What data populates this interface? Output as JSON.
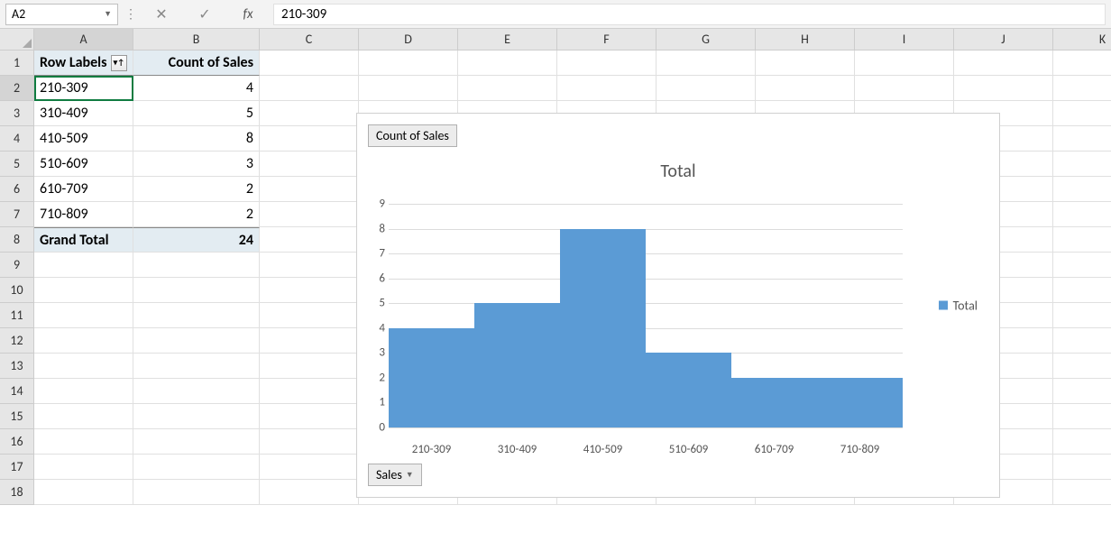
{
  "namebox": "A2",
  "formula": "210-309",
  "columns": [
    "A",
    "B",
    "C",
    "D",
    "E",
    "F",
    "G",
    "H",
    "I",
    "J",
    "K"
  ],
  "rowcount": 18,
  "pivot": {
    "header_rowlabels": "Row Labels",
    "header_count": "Count of Sales",
    "rows": [
      {
        "label": "210-309",
        "count": 4
      },
      {
        "label": "310-409",
        "count": 5
      },
      {
        "label": "410-509",
        "count": 8
      },
      {
        "label": "510-609",
        "count": 3
      },
      {
        "label": "610-709",
        "count": 2
      },
      {
        "label": "710-809",
        "count": 2
      }
    ],
    "grand_label": "Grand Total",
    "grand_value": 24
  },
  "chart_data": {
    "type": "bar",
    "title": "Total",
    "field_button": "Count of Sales",
    "axis_button": "Sales",
    "legend": "Total",
    "categories": [
      "210-309",
      "310-409",
      "410-509",
      "510-609",
      "610-709",
      "710-809"
    ],
    "values": [
      4,
      5,
      8,
      3,
      2,
      2
    ],
    "ylim": [
      0,
      9
    ],
    "yticks": [
      0,
      1,
      2,
      3,
      4,
      5,
      6,
      7,
      8,
      9
    ],
    "xlabel": "",
    "ylabel": ""
  }
}
